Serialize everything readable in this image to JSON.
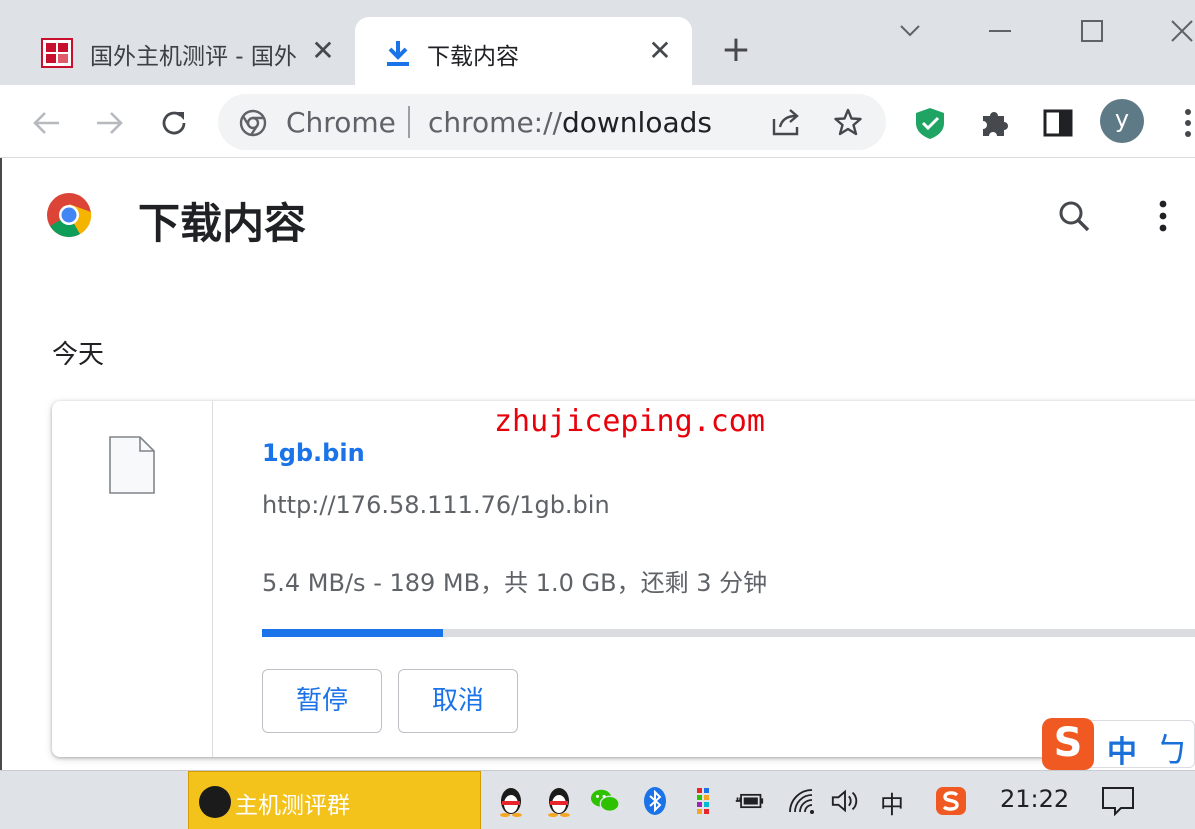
{
  "browser": {
    "tabs": [
      {
        "title": "国外主机测评 - 国外",
        "active": false,
        "close": "✕"
      },
      {
        "title": "下载内容",
        "active": true,
        "close": "✕"
      }
    ],
    "new_tab_label": "+",
    "omnibox": {
      "site_label": "Chrome",
      "url_scheme": "chrome://",
      "url_path": "downloads"
    },
    "profile_initial": "y"
  },
  "page": {
    "title": "下载内容",
    "date_heading": "今天",
    "download": {
      "file_name": "1gb.bin",
      "url": "http://176.58.111.76/1gb.bin",
      "status": "5.4 MB/s - 189 MB，共 1.0 GB，还剩 3 分钟",
      "progress_fraction": 0.19,
      "pause_label": "暂停",
      "cancel_label": "取消"
    },
    "watermark": "zhujiceping.com"
  },
  "ime": {
    "logo": "S",
    "mode": "中",
    "punct": "ㄅ"
  },
  "taskbar": {
    "app_label": "主机测评群",
    "tray_lang": "中",
    "clock": "21:22"
  },
  "colors": {
    "accent": "#1a73e8",
    "tabstrip": "#dee1e6",
    "watermark": "#e8000b",
    "taskbar_app": "#f3c21b",
    "ime_logo": "#f05a22"
  }
}
